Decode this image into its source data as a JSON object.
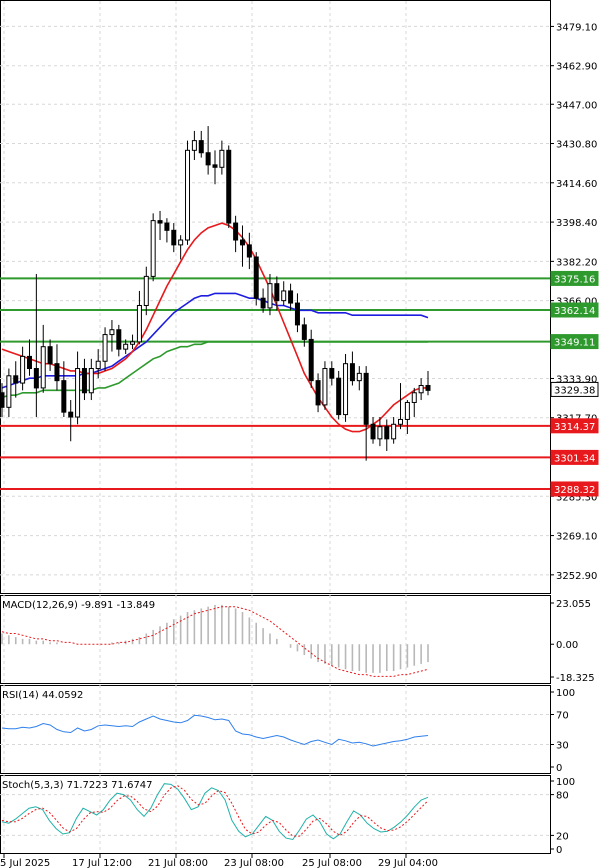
{
  "chart_data": [
    {
      "type": "candlestick",
      "panel": "price",
      "ylim": [
        3245,
        3490
      ],
      "y_ticks": [
        "3479.10",
        "3462.90",
        "3447.00",
        "3430.80",
        "3414.60",
        "3398.40",
        "3382.20",
        "3366.00",
        "3333.90",
        "3317.70",
        "3285.30",
        "3269.10",
        "3252.90"
      ],
      "price_labels": [
        {
          "value": "3375.16",
          "color": "#2e9a2e"
        },
        {
          "value": "3362.14",
          "color": "#2e9a2e"
        },
        {
          "value": "3349.11",
          "color": "#2e9a2e"
        },
        {
          "value": "3329.38",
          "color": "#555555"
        },
        {
          "value": "3314.37",
          "color": "#e8191c"
        },
        {
          "value": "3301.34",
          "color": "#e8191c"
        },
        {
          "value": "3288.32",
          "color": "#e8191c"
        }
      ],
      "candles": [
        {
          "o": 3328,
          "h": 3332,
          "l": 3318,
          "c": 3322
        },
        {
          "o": 3322,
          "h": 3338,
          "l": 3318,
          "c": 3335
        },
        {
          "o": 3335,
          "h": 3341,
          "l": 3326,
          "c": 3332
        },
        {
          "o": 3332,
          "h": 3347,
          "l": 3329,
          "c": 3343
        },
        {
          "o": 3343,
          "h": 3350,
          "l": 3335,
          "c": 3338
        },
        {
          "o": 3338,
          "h": 3377,
          "l": 3318,
          "c": 3330
        },
        {
          "o": 3330,
          "h": 3356,
          "l": 3328,
          "c": 3347
        },
        {
          "o": 3347,
          "h": 3350,
          "l": 3337,
          "c": 3340
        },
        {
          "o": 3340,
          "h": 3348,
          "l": 3329,
          "c": 3333
        },
        {
          "o": 3333,
          "h": 3341,
          "l": 3318,
          "c": 3320
        },
        {
          "o": 3320,
          "h": 3325,
          "l": 3308,
          "c": 3318
        },
        {
          "o": 3318,
          "h": 3345,
          "l": 3315,
          "c": 3338
        },
        {
          "o": 3338,
          "h": 3342,
          "l": 3325,
          "c": 3328
        },
        {
          "o": 3328,
          "h": 3342,
          "l": 3325,
          "c": 3338
        },
        {
          "o": 3338,
          "h": 3346,
          "l": 3334,
          "c": 3341
        },
        {
          "o": 3341,
          "h": 3355,
          "l": 3337,
          "c": 3352
        },
        {
          "o": 3352,
          "h": 3358,
          "l": 3345,
          "c": 3354
        },
        {
          "o": 3354,
          "h": 3356,
          "l": 3343,
          "c": 3346
        },
        {
          "o": 3346,
          "h": 3350,
          "l": 3344,
          "c": 3348
        },
        {
          "o": 3348,
          "h": 3352,
          "l": 3346,
          "c": 3349
        },
        {
          "o": 3349,
          "h": 3370,
          "l": 3348,
          "c": 3364
        },
        {
          "o": 3364,
          "h": 3380,
          "l": 3360,
          "c": 3376
        },
        {
          "o": 3376,
          "h": 3402,
          "l": 3374,
          "c": 3399
        },
        {
          "o": 3399,
          "h": 3403,
          "l": 3391,
          "c": 3398
        },
        {
          "o": 3398,
          "h": 3400,
          "l": 3390,
          "c": 3395
        },
        {
          "o": 3395,
          "h": 3398,
          "l": 3386,
          "c": 3389
        },
        {
          "o": 3389,
          "h": 3393,
          "l": 3383,
          "c": 3391
        },
        {
          "o": 3391,
          "h": 3432,
          "l": 3389,
          "c": 3428
        },
        {
          "o": 3428,
          "h": 3436,
          "l": 3424,
          "c": 3432
        },
        {
          "o": 3432,
          "h": 3436,
          "l": 3425,
          "c": 3427
        },
        {
          "o": 3427,
          "h": 3438,
          "l": 3418,
          "c": 3422
        },
        {
          "o": 3422,
          "h": 3428,
          "l": 3414,
          "c": 3421
        },
        {
          "o": 3421,
          "h": 3432,
          "l": 3418,
          "c": 3428
        },
        {
          "o": 3428,
          "h": 3430,
          "l": 3396,
          "c": 3398
        },
        {
          "o": 3398,
          "h": 3401,
          "l": 3386,
          "c": 3391
        },
        {
          "o": 3391,
          "h": 3397,
          "l": 3380,
          "c": 3389
        },
        {
          "o": 3389,
          "h": 3394,
          "l": 3379,
          "c": 3384
        },
        {
          "o": 3384,
          "h": 3386,
          "l": 3364,
          "c": 3367
        },
        {
          "o": 3367,
          "h": 3371,
          "l": 3361,
          "c": 3363
        },
        {
          "o": 3363,
          "h": 3377,
          "l": 3360,
          "c": 3373
        },
        {
          "o": 3373,
          "h": 3376,
          "l": 3362,
          "c": 3366
        },
        {
          "o": 3366,
          "h": 3374,
          "l": 3364,
          "c": 3370
        },
        {
          "o": 3370,
          "h": 3373,
          "l": 3362,
          "c": 3365
        },
        {
          "o": 3365,
          "h": 3369,
          "l": 3353,
          "c": 3356
        },
        {
          "o": 3356,
          "h": 3359,
          "l": 3347,
          "c": 3350
        },
        {
          "o": 3350,
          "h": 3354,
          "l": 3330,
          "c": 3333
        },
        {
          "o": 3333,
          "h": 3336,
          "l": 3320,
          "c": 3323
        },
        {
          "o": 3323,
          "h": 3341,
          "l": 3321,
          "c": 3338
        },
        {
          "o": 3338,
          "h": 3341,
          "l": 3331,
          "c": 3334
        },
        {
          "o": 3334,
          "h": 3337,
          "l": 3317,
          "c": 3319
        },
        {
          "o": 3319,
          "h": 3344,
          "l": 3316,
          "c": 3340
        },
        {
          "o": 3340,
          "h": 3345,
          "l": 3331,
          "c": 3333
        },
        {
          "o": 3333,
          "h": 3339,
          "l": 3329,
          "c": 3336
        },
        {
          "o": 3336,
          "h": 3339,
          "l": 3300,
          "c": 3315
        },
        {
          "o": 3315,
          "h": 3318,
          "l": 3307,
          "c": 3309
        },
        {
          "o": 3309,
          "h": 3318,
          "l": 3306,
          "c": 3314
        },
        {
          "o": 3314,
          "h": 3317,
          "l": 3304,
          "c": 3309
        },
        {
          "o": 3309,
          "h": 3318,
          "l": 3307,
          "c": 3315
        },
        {
          "o": 3315,
          "h": 3332,
          "l": 3313,
          "c": 3317
        },
        {
          "o": 3317,
          "h": 3325,
          "l": 3311,
          "c": 3324
        },
        {
          "o": 3324,
          "h": 3330,
          "l": 3318,
          "c": 3328
        },
        {
          "o": 3328,
          "h": 3334,
          "l": 3325,
          "c": 3331
        },
        {
          "o": 3331,
          "h": 3337,
          "l": 3327,
          "c": 3329
        }
      ],
      "ma_red": [
        3346,
        3345,
        3344,
        3343,
        3342,
        3341,
        3340,
        3340,
        3339,
        3338,
        3337,
        3337,
        3336,
        3336,
        3336,
        3337,
        3338,
        3340,
        3342,
        3345,
        3349,
        3354,
        3360,
        3366,
        3372,
        3377,
        3382,
        3387,
        3391,
        3394,
        3396,
        3397,
        3398,
        3397,
        3395,
        3392,
        3388,
        3383,
        3377,
        3371,
        3364,
        3357,
        3350,
        3343,
        3336,
        3331,
        3326,
        3322,
        3318,
        3315,
        3313,
        3312,
        3312,
        3313,
        3315,
        3317,
        3320,
        3323,
        3325,
        3327,
        3329,
        3330,
        3330
      ],
      "ma_blue": [
        3330,
        3331,
        3332,
        3333,
        3334,
        3334,
        3335,
        3335,
        3335,
        3335,
        3335,
        3335,
        3336,
        3336,
        3337,
        3338,
        3339,
        3341,
        3343,
        3345,
        3347,
        3349,
        3352,
        3355,
        3358,
        3361,
        3363,
        3365,
        3367,
        3368,
        3368,
        3369,
        3369,
        3369,
        3369,
        3368,
        3367,
        3367,
        3366,
        3365,
        3364,
        3364,
        3363,
        3362,
        3362,
        3362,
        3361,
        3361,
        3361,
        3361,
        3361,
        3360,
        3360,
        3360,
        3360,
        3360,
        3360,
        3360,
        3360,
        3360,
        3360,
        3360,
        3359
      ],
      "ma_green": [
        3326,
        3327,
        3327,
        3328,
        3328,
        3328,
        3329,
        3329,
        3329,
        3329,
        3329,
        3329,
        3329,
        3329,
        3330,
        3330,
        3331,
        3332,
        3334,
        3336,
        3338,
        3340,
        3342,
        3343,
        3345,
        3346,
        3347,
        3347,
        3348,
        3348,
        3349,
        3349,
        3349,
        3349,
        3349,
        3349,
        3349,
        3349,
        3349,
        3349,
        3349,
        3349,
        3349,
        3349,
        3349,
        3349,
        3349,
        3349,
        3349,
        3349,
        3349,
        3349,
        3349,
        3349,
        3349,
        3349,
        3349,
        3349,
        3349,
        3349,
        3349,
        3349,
        3349
      ]
    },
    {
      "type": "histogram",
      "panel": "macd",
      "title": "MACD(12,26,9) -9.891 -13.849",
      "ylim": [
        -18.325,
        23.055
      ],
      "y_ticks": [
        "23.055",
        "0.00",
        "-18.325"
      ],
      "histogram": [
        6,
        5,
        4,
        3,
        3,
        2,
        2,
        1,
        1,
        0,
        0,
        0,
        0,
        0,
        0,
        0,
        1,
        1,
        2,
        3,
        4,
        6,
        8,
        10,
        12,
        14,
        16,
        18,
        19,
        20,
        21,
        22,
        22,
        21,
        20,
        18,
        15,
        12,
        9,
        6,
        3,
        0,
        -2,
        -4,
        -6,
        -8,
        -10,
        -11,
        -12,
        -13,
        -14,
        -15,
        -15,
        -16,
        -16,
        -16,
        -15,
        -15,
        -14,
        -13,
        -12,
        -11,
        -10
      ],
      "signal": [
        7,
        6,
        6,
        5,
        4,
        3,
        3,
        2,
        2,
        1,
        1,
        0,
        0,
        0,
        0,
        0,
        0,
        1,
        1,
        2,
        3,
        4,
        5,
        7,
        9,
        11,
        13,
        15,
        17,
        18,
        19,
        20,
        21,
        21,
        21,
        20,
        19,
        17,
        15,
        13,
        10,
        7,
        4,
        1,
        -2,
        -5,
        -8,
        -10,
        -12,
        -14,
        -15,
        -16,
        -17,
        -17,
        -18,
        -18,
        -18,
        -18,
        -17,
        -17,
        -16,
        -15,
        -14
      ]
    },
    {
      "type": "line",
      "panel": "rsi",
      "title": "RSI(14) 44.0592",
      "ylim": [
        0,
        100
      ],
      "y_ticks": [
        "100",
        "70",
        "30",
        "0"
      ],
      "values": [
        52,
        51,
        51,
        53,
        52,
        54,
        58,
        56,
        50,
        47,
        46,
        52,
        48,
        50,
        55,
        56,
        55,
        54,
        55,
        54,
        60,
        64,
        68,
        64,
        62,
        60,
        59,
        62,
        69,
        68,
        66,
        63,
        64,
        62,
        48,
        44,
        43,
        40,
        38,
        40,
        42,
        40,
        36,
        33,
        30,
        34,
        36,
        33,
        30,
        37,
        35,
        32,
        33,
        31,
        28,
        30,
        32,
        34,
        35,
        37,
        40,
        41,
        42
      ]
    },
    {
      "type": "line",
      "panel": "stoch",
      "title": "Stoch(5,3,3) 71.7223 71.6747",
      "ylim": [
        0,
        100
      ],
      "y_ticks": [
        "100",
        "80",
        "20",
        "0"
      ],
      "k": [
        40,
        38,
        44,
        52,
        60,
        62,
        58,
        42,
        30,
        22,
        24,
        45,
        60,
        55,
        50,
        58,
        72,
        82,
        80,
        72,
        58,
        48,
        60,
        80,
        96,
        95,
        88,
        74,
        58,
        62,
        82,
        90,
        86,
        72,
        42,
        26,
        18,
        22,
        35,
        48,
        42,
        26,
        16,
        14,
        28,
        44,
        50,
        40,
        22,
        15,
        22,
        40,
        56,
        50,
        38,
        30,
        25,
        26,
        32,
        40,
        50,
        62,
        72,
        76
      ],
      "d": [
        42,
        40,
        40,
        45,
        52,
        58,
        60,
        54,
        43,
        31,
        25,
        30,
        43,
        53,
        55,
        54,
        60,
        71,
        78,
        78,
        70,
        59,
        55,
        63,
        79,
        90,
        93,
        86,
        73,
        65,
        67,
        78,
        86,
        83,
        67,
        47,
        29,
        22,
        25,
        35,
        42,
        39,
        28,
        19,
        19,
        29,
        41,
        45,
        37,
        26,
        20,
        26,
        39,
        49,
        48,
        39,
        31,
        27,
        28,
        33,
        41,
        51,
        61,
        71
      ]
    }
  ],
  "x_labels": [
    "5 Jul 2025",
    "17 Jul 12:00",
    "21 Jul 08:00",
    "23 Jul 08:00",
    "25 Jul 08:00",
    "29 Jul 04:00"
  ]
}
